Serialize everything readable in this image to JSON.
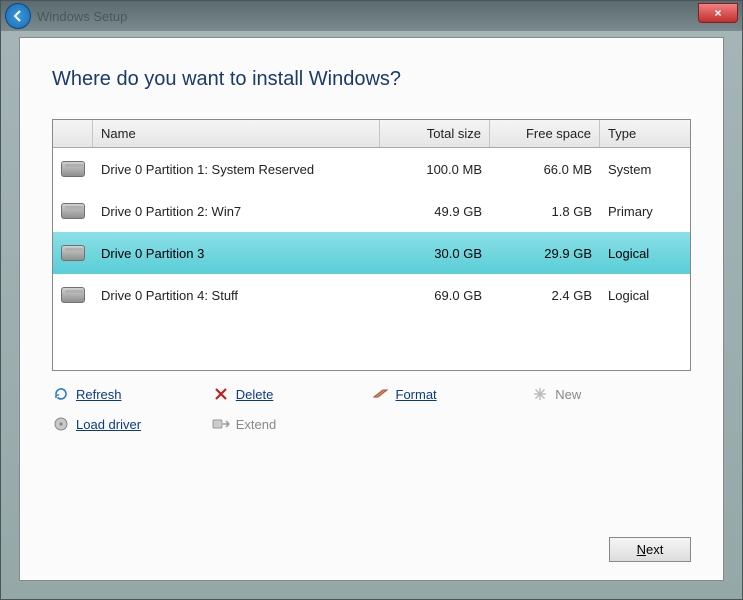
{
  "window": {
    "title": "Windows Setup",
    "close": "×"
  },
  "heading": "Where do you want to install Windows?",
  "grid": {
    "headers": {
      "name": "Name",
      "total": "Total size",
      "free": "Free space",
      "type": "Type"
    },
    "rows": [
      {
        "name": "Drive 0 Partition 1: System Reserved",
        "total": "100.0 MB",
        "free": "66.0 MB",
        "type": "System",
        "selected": false
      },
      {
        "name": "Drive 0 Partition 2: Win7",
        "total": "49.9 GB",
        "free": "1.8 GB",
        "type": "Primary",
        "selected": false
      },
      {
        "name": "Drive 0 Partition 3",
        "total": "30.0 GB",
        "free": "29.9 GB",
        "type": "Logical",
        "selected": true
      },
      {
        "name": "Drive 0 Partition 4: Stuff",
        "total": "69.0 GB",
        "free": "2.4 GB",
        "type": "Logical",
        "selected": false
      }
    ]
  },
  "actions": {
    "refresh": "Refresh",
    "delete": "Delete",
    "format": "Format",
    "new": "New",
    "load_driver": "Load driver",
    "extend": "Extend"
  },
  "footer": {
    "next": "Next"
  }
}
